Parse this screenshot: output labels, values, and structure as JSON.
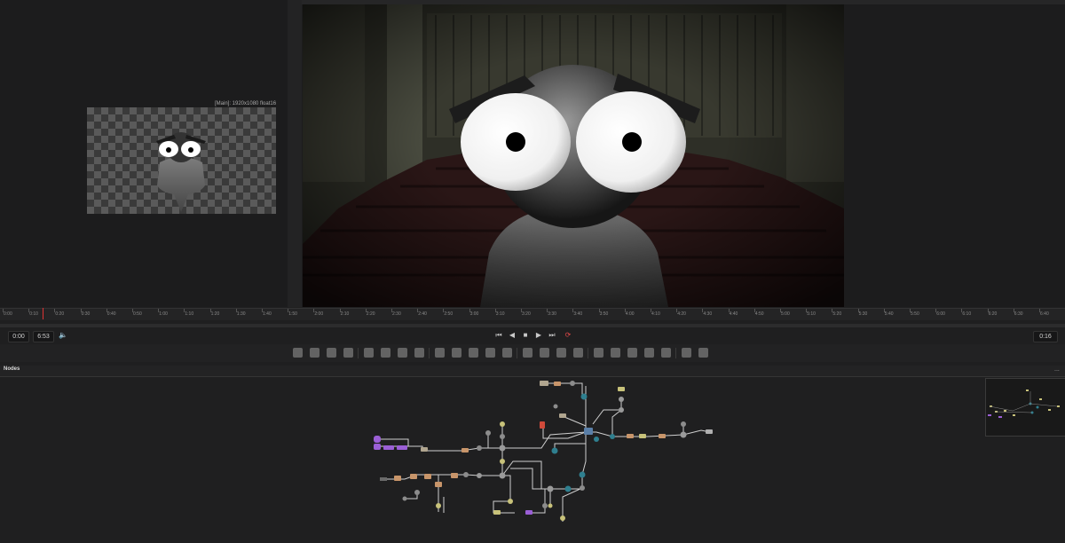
{
  "viewer_left": {
    "label": "[Main]: 1920x1080 float16"
  },
  "viewer_right": {
    "label": ""
  },
  "timeline": {
    "ticks": [
      "0:00",
      "0:10",
      "0:20",
      "0:30",
      "0:40",
      "0:50",
      "1:00",
      "1:10",
      "1:20",
      "1:30",
      "1:40",
      "1:50",
      "2:00",
      "2:10",
      "2:20",
      "2:30",
      "2:40",
      "2:50",
      "3:00",
      "3:10",
      "3:20",
      "3:30",
      "3:40",
      "3:50",
      "4:00",
      "4:10",
      "4:20",
      "4:30",
      "4:40",
      "4:50",
      "5:00",
      "5:10",
      "5:20",
      "5:30",
      "5:40",
      "5:50",
      "6:00",
      "6:10",
      "6:20",
      "6:30",
      "6:40",
      "6:50"
    ],
    "playhead_position_fraction": 0.04
  },
  "transport": {
    "start_time": "0:00",
    "end_time": "6:53",
    "current_time": "0:16",
    "buttons": [
      "skip-to-start",
      "step-back",
      "stop",
      "play",
      "skip-to-end",
      "loop"
    ]
  },
  "toolbar": {
    "tools": [
      "background",
      "loader",
      "text",
      "paint",
      "particles",
      "blur",
      "glow",
      "color-correct",
      "merge",
      "rectangle-mask",
      "ellipse-mask",
      "polygon-mask",
      "bspline-mask",
      "transform",
      "tracker",
      "planar-tracker",
      "renderer3d",
      "shape3d",
      "merge3d",
      "camera3d",
      "light3d",
      "image-plane3d",
      "fbx-mesh",
      "point-cloud"
    ]
  },
  "nodes": {
    "title": "Nodes",
    "menu": "..."
  },
  "colors": {
    "panel_bg": "#1f1f20",
    "playhead": "#dd3333",
    "node_purple": "#9b5fd6",
    "node_orange": "#c8956a",
    "node_teal": "#2f7f8f",
    "node_gray": "#9a9a9a",
    "connection": "#d8d8d8"
  }
}
